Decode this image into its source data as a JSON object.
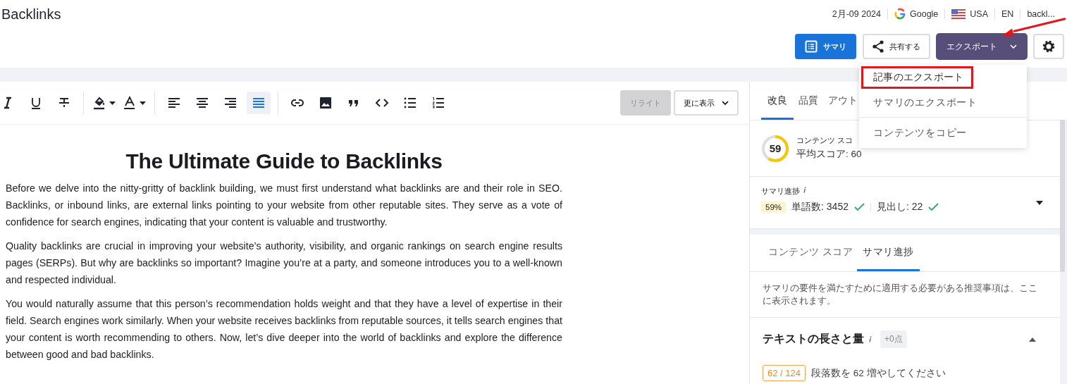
{
  "header": {
    "title": "Backlinks",
    "date": "2月-09 2024",
    "engine": "Google",
    "country": "USA",
    "language": "EN",
    "keyword": "backl..."
  },
  "actions": [
    {
      "kind": "summary",
      "label": "サマリ"
    },
    {
      "kind": "share",
      "label": "共有する"
    },
    {
      "kind": "export",
      "label": "エクスポート",
      "expanded": true
    },
    {
      "kind": "settings"
    }
  ],
  "export_menu": {
    "items": [
      {
        "label": "記事のエクスポート",
        "highlighted": true
      },
      {
        "label": "サマリのエクスポート",
        "highlighted": false
      },
      {
        "label": "コンテンツをコピー",
        "highlighted": false
      }
    ]
  },
  "toolbar": {
    "groups": [
      [
        {
          "kind": "italic",
          "active": false
        },
        {
          "kind": "underline",
          "active": false
        },
        {
          "kind": "strike",
          "active": false
        }
      ],
      [
        {
          "kind": "fill",
          "active": false
        },
        {
          "kind": "textcolor",
          "active": false
        }
      ],
      [
        {
          "kind": "align-left",
          "active": false
        },
        {
          "kind": "align-center",
          "active": false
        },
        {
          "kind": "align-right",
          "active": false
        },
        {
          "kind": "justify",
          "active": true
        }
      ],
      [
        {
          "kind": "link",
          "active": false
        },
        {
          "kind": "image",
          "active": false
        },
        {
          "kind": "quote",
          "active": false
        },
        {
          "kind": "code",
          "active": false
        },
        {
          "kind": "bullets",
          "active": false
        },
        {
          "kind": "numbers",
          "active": false
        }
      ]
    ],
    "rewrite": {
      "label": "リライト",
      "disabled": true
    },
    "more": "更に表示"
  },
  "article": {
    "heading": "The Ultimate Guide to Backlinks",
    "paragraphs": [
      "Before we delve into the nitty-gritty of backlink building, we must first understand what backlinks are and their role in SEO. Backlinks, or inbound links, are external links pointing to your website from other reputable sites. They serve as a vote of confidence for search engines, indicating that your content is valuable and trustworthy.",
      "Quality backlinks are crucial in improving your website’s authority, visibility, and organic rankings on search engine results pages (SERPs). But why are backlinks so important? Imagine you’re at a party, and someone introduces you to a well-known and respected individual.",
      "You would naturally assume that this person’s recommendation holds weight and that they have a level of expertise in their field. Search engines work similarly. When your website receives backlinks from reputable sources, it tells search engines that your content is worth recommending to others. Now, let’s dive deeper into the world of backlinks and explore the difference between good and bad backlinks."
    ]
  },
  "panel": {
    "tabs": [
      {
        "label": "改良",
        "selected": true
      },
      {
        "label": "品質",
        "selected": false
      },
      {
        "label": "アウト",
        "selected": false
      }
    ],
    "content_score": {
      "label": "コンテンツ スコ",
      "score": "59",
      "level": 0.59,
      "average": "平均スコア: 60"
    },
    "summary_progress": {
      "label": "サマリ進捗",
      "percent": "59%",
      "words": "単語数: 3452",
      "headings": "見出し: 22"
    },
    "subtabs": [
      {
        "label": "コンテンツ スコア",
        "selected": false
      },
      {
        "label": "サマリ進捗",
        "selected": true
      }
    ],
    "hint": "サマリの要件を満たすために適用する必要がある推奨事項は、ここに表示されます。",
    "section": {
      "title": "テキストの長さと量",
      "points": "+0点",
      "expanded": true,
      "requirement": {
        "count": "62 / 124",
        "text": "段落数を 62 増やしてください"
      }
    }
  }
}
